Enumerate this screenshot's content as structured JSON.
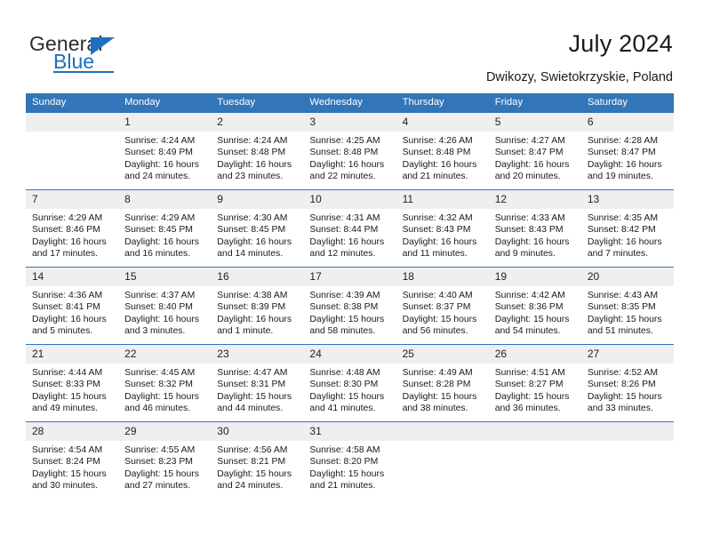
{
  "brand": {
    "name_top": "General",
    "name_bottom": "Blue",
    "accent_color": "#1f6fbf"
  },
  "header": {
    "title": "July 2024",
    "subtitle": "Dwikozy, Swietokrzyskie, Poland"
  },
  "calendar": {
    "header_color": "#3275b8",
    "daynum_band_color": "#efefef",
    "weekdays": [
      "Sunday",
      "Monday",
      "Tuesday",
      "Wednesday",
      "Thursday",
      "Friday",
      "Saturday"
    ],
    "labels": {
      "sunrise": "Sunrise:",
      "sunset": "Sunset:",
      "daylight": "Daylight:"
    },
    "weeks": [
      [
        {
          "day": "",
          "blank": true
        },
        {
          "day": "1",
          "sunrise": "Sunrise: 4:24 AM",
          "sunset": "Sunset: 8:49 PM",
          "daylight1": "Daylight: 16 hours",
          "daylight2": "and 24 minutes."
        },
        {
          "day": "2",
          "sunrise": "Sunrise: 4:24 AM",
          "sunset": "Sunset: 8:48 PM",
          "daylight1": "Daylight: 16 hours",
          "daylight2": "and 23 minutes."
        },
        {
          "day": "3",
          "sunrise": "Sunrise: 4:25 AM",
          "sunset": "Sunset: 8:48 PM",
          "daylight1": "Daylight: 16 hours",
          "daylight2": "and 22 minutes."
        },
        {
          "day": "4",
          "sunrise": "Sunrise: 4:26 AM",
          "sunset": "Sunset: 8:48 PM",
          "daylight1": "Daylight: 16 hours",
          "daylight2": "and 21 minutes."
        },
        {
          "day": "5",
          "sunrise": "Sunrise: 4:27 AM",
          "sunset": "Sunset: 8:47 PM",
          "daylight1": "Daylight: 16 hours",
          "daylight2": "and 20 minutes."
        },
        {
          "day": "6",
          "sunrise": "Sunrise: 4:28 AM",
          "sunset": "Sunset: 8:47 PM",
          "daylight1": "Daylight: 16 hours",
          "daylight2": "and 19 minutes."
        }
      ],
      [
        {
          "day": "7",
          "sunrise": "Sunrise: 4:29 AM",
          "sunset": "Sunset: 8:46 PM",
          "daylight1": "Daylight: 16 hours",
          "daylight2": "and 17 minutes."
        },
        {
          "day": "8",
          "sunrise": "Sunrise: 4:29 AM",
          "sunset": "Sunset: 8:45 PM",
          "daylight1": "Daylight: 16 hours",
          "daylight2": "and 16 minutes."
        },
        {
          "day": "9",
          "sunrise": "Sunrise: 4:30 AM",
          "sunset": "Sunset: 8:45 PM",
          "daylight1": "Daylight: 16 hours",
          "daylight2": "and 14 minutes."
        },
        {
          "day": "10",
          "sunrise": "Sunrise: 4:31 AM",
          "sunset": "Sunset: 8:44 PM",
          "daylight1": "Daylight: 16 hours",
          "daylight2": "and 12 minutes."
        },
        {
          "day": "11",
          "sunrise": "Sunrise: 4:32 AM",
          "sunset": "Sunset: 8:43 PM",
          "daylight1": "Daylight: 16 hours",
          "daylight2": "and 11 minutes."
        },
        {
          "day": "12",
          "sunrise": "Sunrise: 4:33 AM",
          "sunset": "Sunset: 8:43 PM",
          "daylight1": "Daylight: 16 hours",
          "daylight2": "and 9 minutes."
        },
        {
          "day": "13",
          "sunrise": "Sunrise: 4:35 AM",
          "sunset": "Sunset: 8:42 PM",
          "daylight1": "Daylight: 16 hours",
          "daylight2": "and 7 minutes."
        }
      ],
      [
        {
          "day": "14",
          "sunrise": "Sunrise: 4:36 AM",
          "sunset": "Sunset: 8:41 PM",
          "daylight1": "Daylight: 16 hours",
          "daylight2": "and 5 minutes."
        },
        {
          "day": "15",
          "sunrise": "Sunrise: 4:37 AM",
          "sunset": "Sunset: 8:40 PM",
          "daylight1": "Daylight: 16 hours",
          "daylight2": "and 3 minutes."
        },
        {
          "day": "16",
          "sunrise": "Sunrise: 4:38 AM",
          "sunset": "Sunset: 8:39 PM",
          "daylight1": "Daylight: 16 hours",
          "daylight2": "and 1 minute."
        },
        {
          "day": "17",
          "sunrise": "Sunrise: 4:39 AM",
          "sunset": "Sunset: 8:38 PM",
          "daylight1": "Daylight: 15 hours",
          "daylight2": "and 58 minutes."
        },
        {
          "day": "18",
          "sunrise": "Sunrise: 4:40 AM",
          "sunset": "Sunset: 8:37 PM",
          "daylight1": "Daylight: 15 hours",
          "daylight2": "and 56 minutes."
        },
        {
          "day": "19",
          "sunrise": "Sunrise: 4:42 AM",
          "sunset": "Sunset: 8:36 PM",
          "daylight1": "Daylight: 15 hours",
          "daylight2": "and 54 minutes."
        },
        {
          "day": "20",
          "sunrise": "Sunrise: 4:43 AM",
          "sunset": "Sunset: 8:35 PM",
          "daylight1": "Daylight: 15 hours",
          "daylight2": "and 51 minutes."
        }
      ],
      [
        {
          "day": "21",
          "sunrise": "Sunrise: 4:44 AM",
          "sunset": "Sunset: 8:33 PM",
          "daylight1": "Daylight: 15 hours",
          "daylight2": "and 49 minutes."
        },
        {
          "day": "22",
          "sunrise": "Sunrise: 4:45 AM",
          "sunset": "Sunset: 8:32 PM",
          "daylight1": "Daylight: 15 hours",
          "daylight2": "and 46 minutes."
        },
        {
          "day": "23",
          "sunrise": "Sunrise: 4:47 AM",
          "sunset": "Sunset: 8:31 PM",
          "daylight1": "Daylight: 15 hours",
          "daylight2": "and 44 minutes."
        },
        {
          "day": "24",
          "sunrise": "Sunrise: 4:48 AM",
          "sunset": "Sunset: 8:30 PM",
          "daylight1": "Daylight: 15 hours",
          "daylight2": "and 41 minutes."
        },
        {
          "day": "25",
          "sunrise": "Sunrise: 4:49 AM",
          "sunset": "Sunset: 8:28 PM",
          "daylight1": "Daylight: 15 hours",
          "daylight2": "and 38 minutes."
        },
        {
          "day": "26",
          "sunrise": "Sunrise: 4:51 AM",
          "sunset": "Sunset: 8:27 PM",
          "daylight1": "Daylight: 15 hours",
          "daylight2": "and 36 minutes."
        },
        {
          "day": "27",
          "sunrise": "Sunrise: 4:52 AM",
          "sunset": "Sunset: 8:26 PM",
          "daylight1": "Daylight: 15 hours",
          "daylight2": "and 33 minutes."
        }
      ],
      [
        {
          "day": "28",
          "sunrise": "Sunrise: 4:54 AM",
          "sunset": "Sunset: 8:24 PM",
          "daylight1": "Daylight: 15 hours",
          "daylight2": "and 30 minutes."
        },
        {
          "day": "29",
          "sunrise": "Sunrise: 4:55 AM",
          "sunset": "Sunset: 8:23 PM",
          "daylight1": "Daylight: 15 hours",
          "daylight2": "and 27 minutes."
        },
        {
          "day": "30",
          "sunrise": "Sunrise: 4:56 AM",
          "sunset": "Sunset: 8:21 PM",
          "daylight1": "Daylight: 15 hours",
          "daylight2": "and 24 minutes."
        },
        {
          "day": "31",
          "sunrise": "Sunrise: 4:58 AM",
          "sunset": "Sunset: 8:20 PM",
          "daylight1": "Daylight: 15 hours",
          "daylight2": "and 21 minutes."
        },
        {
          "day": "",
          "blank": true
        },
        {
          "day": "",
          "blank": true
        },
        {
          "day": "",
          "blank": true
        }
      ]
    ]
  }
}
